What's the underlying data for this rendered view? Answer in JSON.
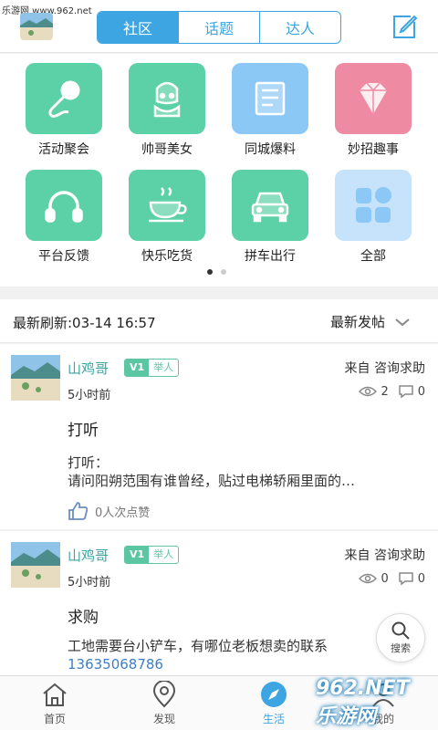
{
  "watermark_top": "乐游网 www.962.net",
  "segment": {
    "tabs": [
      "社区",
      "话题",
      "达人"
    ],
    "active": 0
  },
  "categories": [
    {
      "label": "活动聚会",
      "icon": "microphone-icon",
      "color": "#5cd0a6"
    },
    {
      "label": "帅哥美女",
      "icon": "handsome-girl-icon",
      "color": "#5cd0a6"
    },
    {
      "label": "同城爆料",
      "icon": "newspaper-icon",
      "color": "#8cc8f5"
    },
    {
      "label": "妙招趣事",
      "icon": "diamond-icon",
      "color": "#ef8aa3"
    },
    {
      "label": "平台反馈",
      "icon": "headphones-icon",
      "color": "#5cd0a6"
    },
    {
      "label": "快乐吃货",
      "icon": "coffee-cup-icon",
      "color": "#5cd0a6"
    },
    {
      "label": "拼车出行",
      "icon": "car-icon",
      "color": "#5cd0a6"
    },
    {
      "label": "全部",
      "icon": "grid-icon",
      "color": "#c6e3fb"
    }
  ],
  "feed": {
    "refresh_label": "最新刷新:03-14 16:57",
    "sort_label": "最新发帖"
  },
  "posts": [
    {
      "user": "山鸡哥",
      "level": "V1",
      "title_badge": "举人",
      "time": "5小时前",
      "source": "来自 咨询求助",
      "views": "2",
      "comments": "0",
      "title": "打听",
      "body_line1": "打听：",
      "body_line2": "请问阳朔范围有谁曾经，贴过电梯轿厢里面的…",
      "likes": "0人次点赞"
    },
    {
      "user": "山鸡哥",
      "level": "V1",
      "title_badge": "举人",
      "time": "5小时前",
      "source": "来自 咨询求助",
      "views": "0",
      "comments": "0",
      "title": "求购",
      "body_line1": "工地需要台小铲车，有哪位老板想卖的联系",
      "body_line2": "13635068786"
    }
  ],
  "float_search_label": "搜索",
  "tabbar": [
    {
      "label": "首页",
      "icon": "home-icon"
    },
    {
      "label": "发现",
      "icon": "location-icon"
    },
    {
      "label": "生活",
      "icon": "compass-icon"
    },
    {
      "label": "我的",
      "icon": "user-icon"
    }
  ],
  "watermark_bottom": "962.NET 乐游网",
  "colors": {
    "accent": "#3da5e2",
    "green": "#5cc6a2"
  }
}
